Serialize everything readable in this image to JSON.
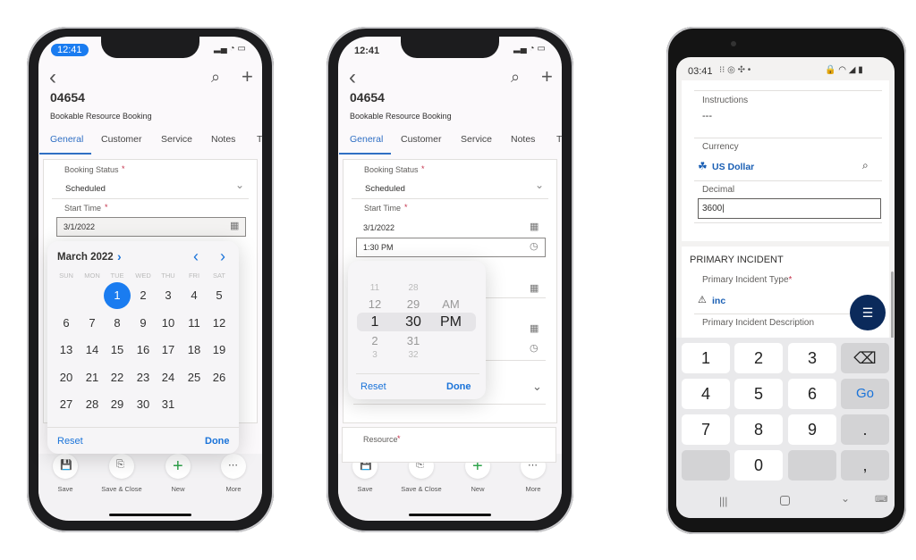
{
  "ios_phones": [
    {
      "status_time": "12:41",
      "record_id": "04654",
      "record_type": "Bookable Resource Booking",
      "tabs": [
        "General",
        "Customer",
        "Service",
        "Notes",
        "T"
      ],
      "booking_status_label": "Booking Status",
      "booking_status_value": "Scheduled",
      "start_time_label": "Start Time",
      "start_date_value": "3/1/2022",
      "toolbar": [
        "Save",
        "Save & Close",
        "New",
        "More"
      ]
    },
    {
      "status_time": "12:41",
      "record_id": "04654",
      "record_type": "Bookable Resource Booking",
      "tabs": [
        "General",
        "Customer",
        "Service",
        "Notes",
        "T"
      ],
      "booking_status_label": "Booking Status",
      "booking_status_value": "Scheduled",
      "start_time_label": "Start Time",
      "start_date_value": "3/1/2022",
      "start_time_value": "1:30 PM",
      "resource_label": "Resource",
      "toolbar": [
        "Save",
        "Save & Close",
        "New",
        "More"
      ]
    }
  ],
  "calendar": {
    "month_label": "March 2022",
    "weekdays": [
      "SUN",
      "MON",
      "TUE",
      "WED",
      "THU",
      "FRI",
      "SAT"
    ],
    "first_weekday_index": 2,
    "days_in_month": 31,
    "selected_day": "1",
    "reset": "Reset",
    "done": "Done"
  },
  "time_picker": {
    "hours": [
      "11",
      "12",
      "1",
      "2",
      "3"
    ],
    "minutes": [
      "28",
      "29",
      "30",
      "31",
      "32"
    ],
    "periods": [
      "AM",
      "PM"
    ],
    "selected": {
      "hour": "1",
      "minute": "30",
      "period": "PM"
    },
    "reset": "Reset",
    "done": "Done"
  },
  "android": {
    "status_time": "03:41",
    "instructions_label": "Instructions",
    "instructions_value": "---",
    "currency_label": "Currency",
    "currency_value": "US Dollar",
    "decimal_label": "Decimal",
    "decimal_value": "3600",
    "section_title": "PRIMARY INCIDENT",
    "incident_type_label": "Primary Incident Type",
    "incident_type_value": "inc",
    "incident_desc_label": "Primary Incident Description",
    "keys": [
      "1",
      "2",
      "3",
      "⌫",
      "4",
      "5",
      "6",
      "Go",
      "7",
      "8",
      "9",
      ".",
      "",
      "0",
      "",
      ","
    ]
  },
  "colors": {
    "accent": "#1a73d9",
    "selected_day": "#1a7cf0",
    "fab": "#0b2a5b",
    "required": "#c4314b"
  }
}
